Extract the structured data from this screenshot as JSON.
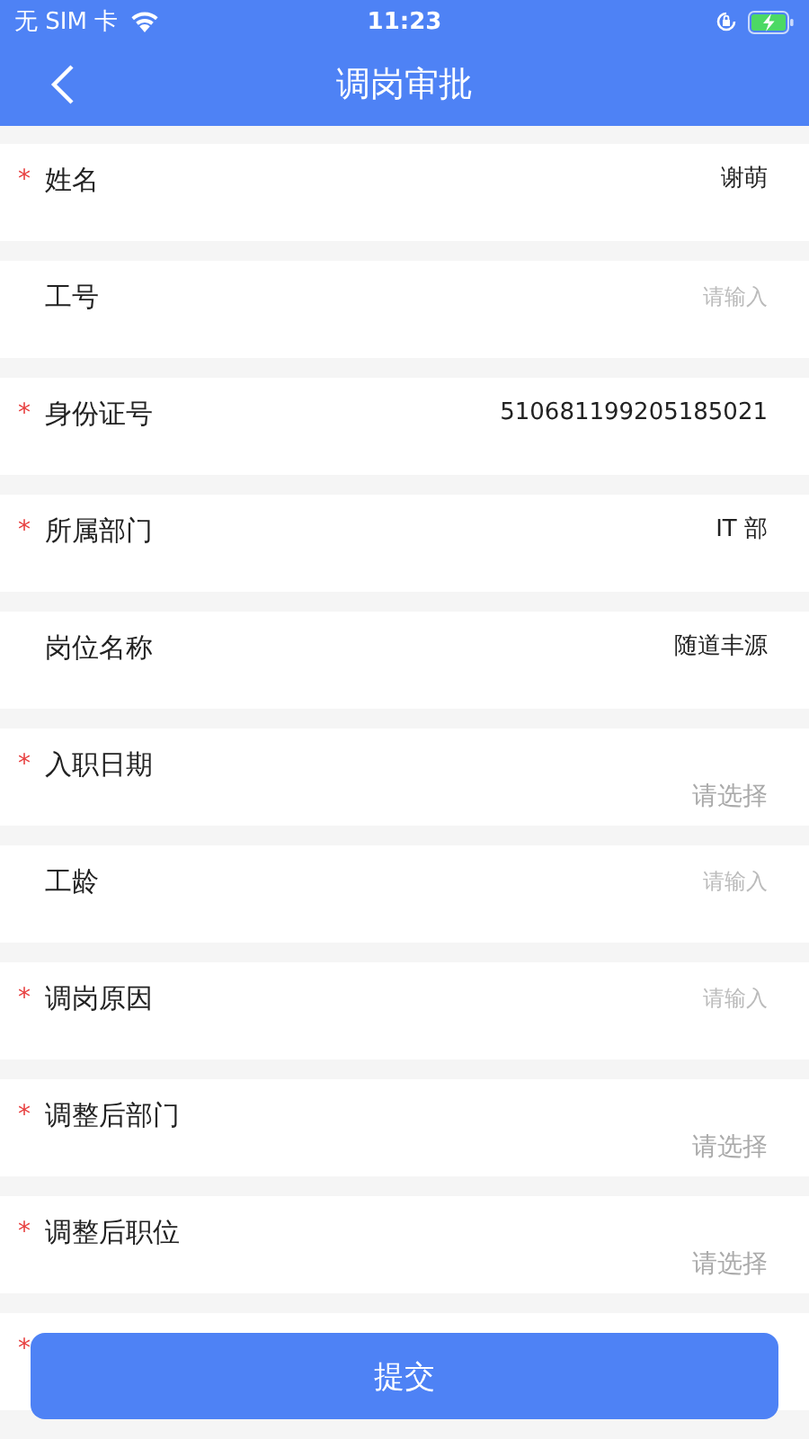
{
  "status_bar": {
    "carrier": "无 SIM 卡",
    "time": "11:23"
  },
  "nav": {
    "title": "调岗审批"
  },
  "fields": [
    {
      "mark": "*",
      "label": "姓名",
      "value": "谢萌"
    },
    {
      "label": "工号",
      "kind": "input",
      "placeholder": "请输入"
    },
    {
      "mark": "*",
      "label": "身份证号",
      "value": "510681199205185021"
    },
    {
      "mark": "*",
      "label": "所属部门",
      "value": "IT 部"
    },
    {
      "label": "岗位名称",
      "value": "随道丰源"
    },
    {
      "mark": "*",
      "label": "入职日期",
      "kind": "select",
      "placeholder": "请选择"
    },
    {
      "label": "工龄",
      "kind": "input",
      "placeholder": "请输入"
    },
    {
      "mark": "*",
      "label": "调岗原因",
      "kind": "input",
      "placeholder": "请输入"
    },
    {
      "mark": "*",
      "label": "调整后部门",
      "kind": "select",
      "placeholder": "请选择"
    },
    {
      "mark": "*",
      "label": "调整后职位",
      "kind": "select",
      "placeholder": "请选择"
    },
    {
      "mark": "*"
    }
  ],
  "submit": "提交"
}
